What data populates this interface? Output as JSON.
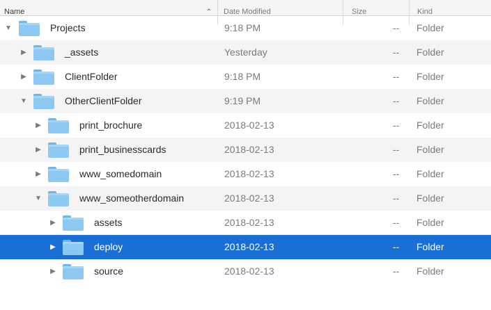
{
  "header": {
    "name": "Name",
    "date": "Date Modified",
    "size": "Size",
    "kind": "Kind",
    "sort_icon": "chevron-up-icon"
  },
  "colors": {
    "selection": "#1a6fd6",
    "folder": "#8cc8f1",
    "alt_row": "#f4f4f4"
  },
  "rows": [
    {
      "name": "Projects",
      "date": "9:18 PM",
      "size": "--",
      "kind": "Folder",
      "expanded": true
    },
    {
      "name": "_assets",
      "date": "Yesterday",
      "size": "--",
      "kind": "Folder",
      "expanded": false
    },
    {
      "name": "ClientFolder",
      "date": "9:18 PM",
      "size": "--",
      "kind": "Folder",
      "expanded": false
    },
    {
      "name": "OtherClientFolder",
      "date": "9:19 PM",
      "size": "--",
      "kind": "Folder",
      "expanded": true
    },
    {
      "name": "print_brochure",
      "date": "2018-02-13",
      "size": "--",
      "kind": "Folder",
      "expanded": false
    },
    {
      "name": "print_businesscards",
      "date": "2018-02-13",
      "size": "--",
      "kind": "Folder",
      "expanded": false
    },
    {
      "name": "www_somedomain",
      "date": "2018-02-13",
      "size": "--",
      "kind": "Folder",
      "expanded": false
    },
    {
      "name": "www_someotherdomain",
      "date": "2018-02-13",
      "size": "--",
      "kind": "Folder",
      "expanded": true
    },
    {
      "name": "assets",
      "date": "2018-02-13",
      "size": "--",
      "kind": "Folder",
      "expanded": false
    },
    {
      "name": "deploy",
      "date": "2018-02-13",
      "size": "--",
      "kind": "Folder",
      "expanded": false,
      "selected": true
    },
    {
      "name": "source",
      "date": "2018-02-13",
      "size": "--",
      "kind": "Folder",
      "expanded": false
    }
  ]
}
